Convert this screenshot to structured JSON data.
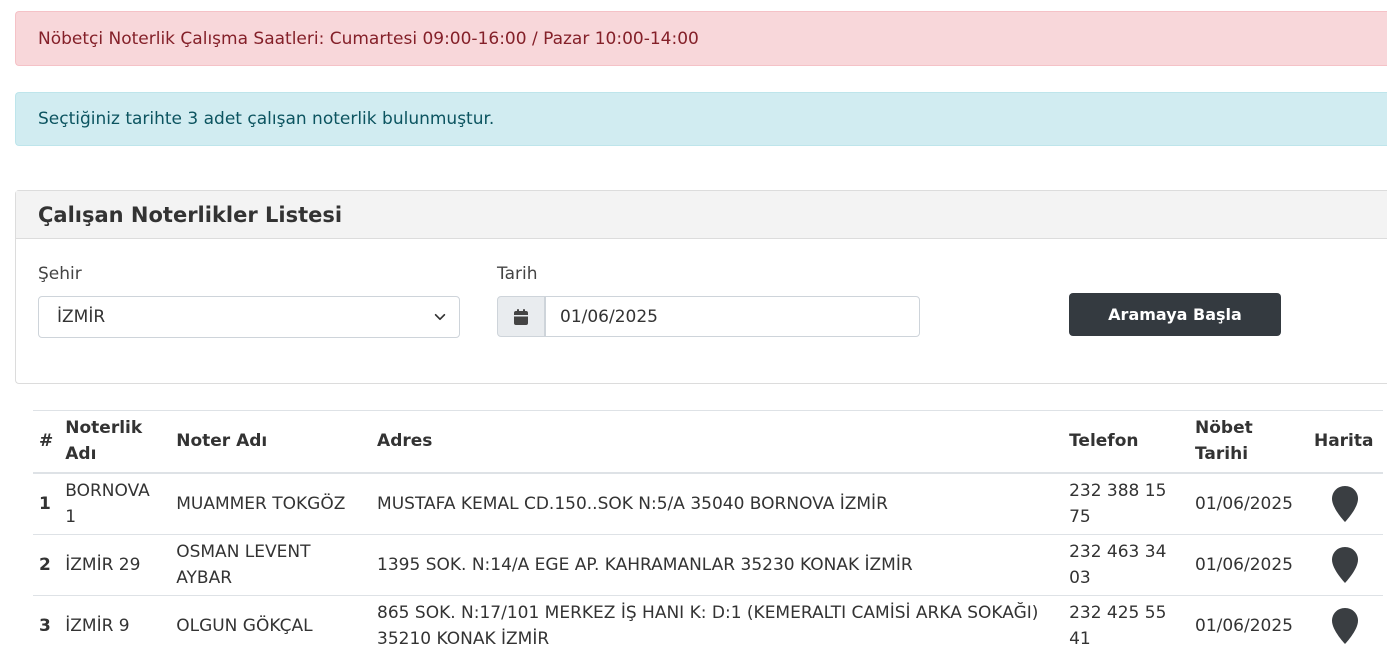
{
  "alerts": {
    "hours": "Nöbetçi Noterlik Çalışma Saatleri: Cumartesi 09:00-16:00 / Pazar 10:00-14:00",
    "result": "Seçtiğiniz tarihte 3 adet çalışan noterlik bulunmuştur."
  },
  "card": {
    "title": "Çalışan Noterlikler Listesi",
    "city_label": "Şehir",
    "city_value": "İZMİR",
    "date_label": "Tarih",
    "date_value": "01/06/2025",
    "search_button": "Aramaya Başla"
  },
  "table": {
    "headers": {
      "num": "#",
      "office": "Noterlik Adı",
      "notary": "Noter Adı",
      "address": "Adres",
      "phone": "Telefon",
      "date": "Nöbet Tarihi",
      "map": "Harita"
    },
    "rows": [
      {
        "num": "1",
        "office": "BORNOVA 1",
        "notary": "MUAMMER TOKGÖZ",
        "address": "MUSTAFA KEMAL CD.150..SOK N:5/A 35040 BORNOVA İZMİR",
        "phone": "232 388 15 75",
        "date": "01/06/2025"
      },
      {
        "num": "2",
        "office": "İZMİR 29",
        "notary": "OSMAN LEVENT AYBAR",
        "address": "1395 SOK. N:14/A EGE AP. KAHRAMANLAR 35230 KONAK İZMİR",
        "phone": "232 463 34 03",
        "date": "01/06/2025"
      },
      {
        "num": "3",
        "office": "İZMİR 9",
        "notary": "OLGUN GÖKÇAL",
        "address": "865 SOK. N:17/101 MERKEZ İŞ HANI K: D:1 (KEMERALTI CAMİSİ ARKA SOKAĞI) 35210 KONAK İZMİR",
        "phone": "232 425 55 41",
        "date": "01/06/2025"
      }
    ]
  },
  "icons": {
    "calendar": "calendar-icon",
    "map": "map-marker-icon",
    "select_arrow": "chevron-down-icon"
  },
  "colors": {
    "danger_bg": "#f8d7da",
    "info_bg": "#d1ecf1",
    "button_bg": "#343a40",
    "pin": "#3a3e42"
  }
}
